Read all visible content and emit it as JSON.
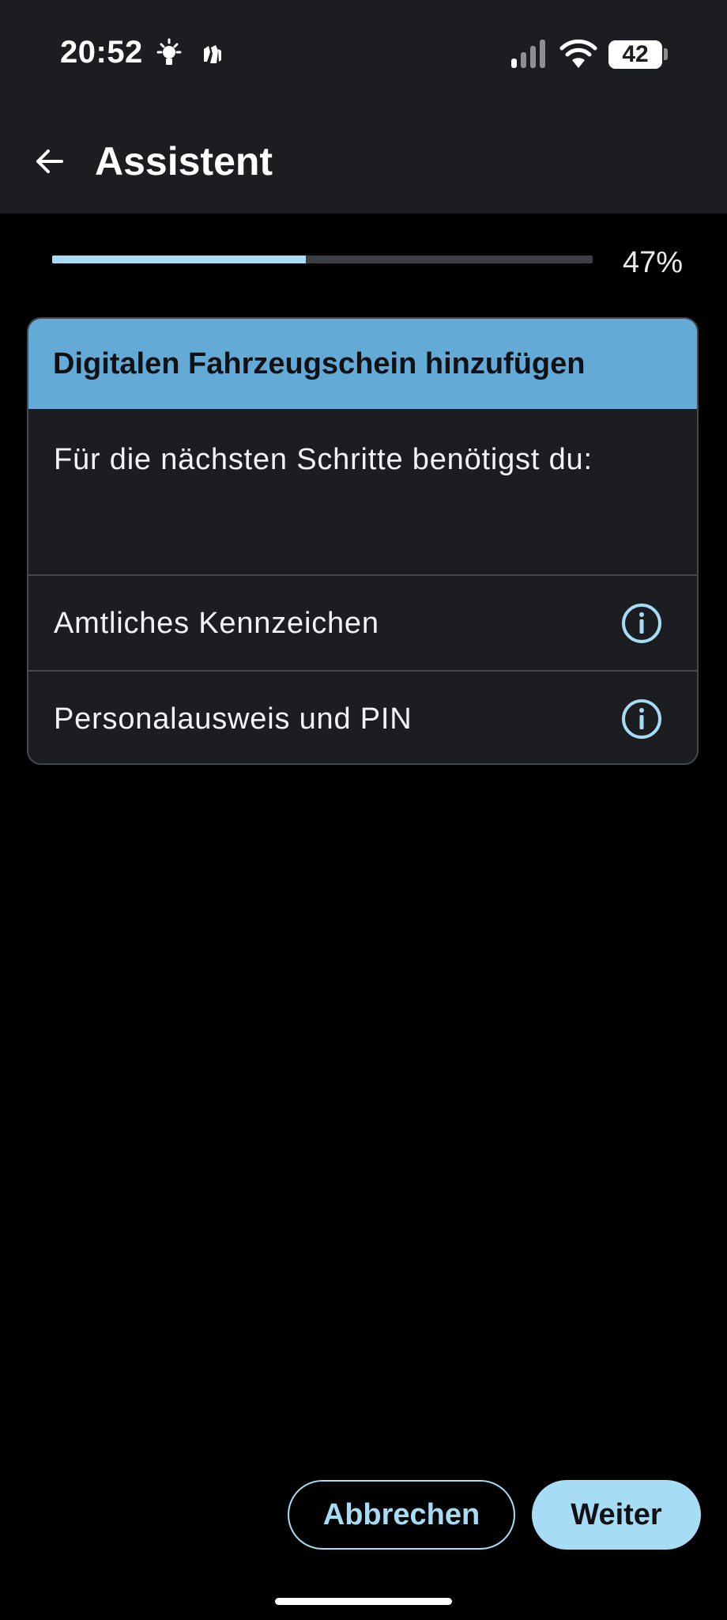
{
  "status_bar": {
    "time": "20:52",
    "icons": [
      "lightbulb-icon",
      "hands-icon",
      "signal-icon",
      "wifi-icon"
    ],
    "battery_level": "42"
  },
  "app_bar": {
    "back_icon": "arrow-left-icon",
    "title": "Assistent"
  },
  "progress": {
    "value_percent": 47,
    "label": "47%"
  },
  "card": {
    "title": "Digitalen Fahrzeugschein hinzufügen",
    "intro": "Für die nächsten Schritte benötigst du:",
    "items": [
      {
        "label": "Amtliches Kennzeichen",
        "icon": "info-icon"
      },
      {
        "label": "Personalausweis und PIN",
        "icon": "info-icon"
      }
    ]
  },
  "actions": {
    "cancel_label": "Abbrechen",
    "next_label": "Weiter"
  },
  "colors": {
    "accent": "#a7dcf5",
    "header_blue": "#63abd6",
    "surface": "#1b1d20",
    "background": "#000000"
  }
}
